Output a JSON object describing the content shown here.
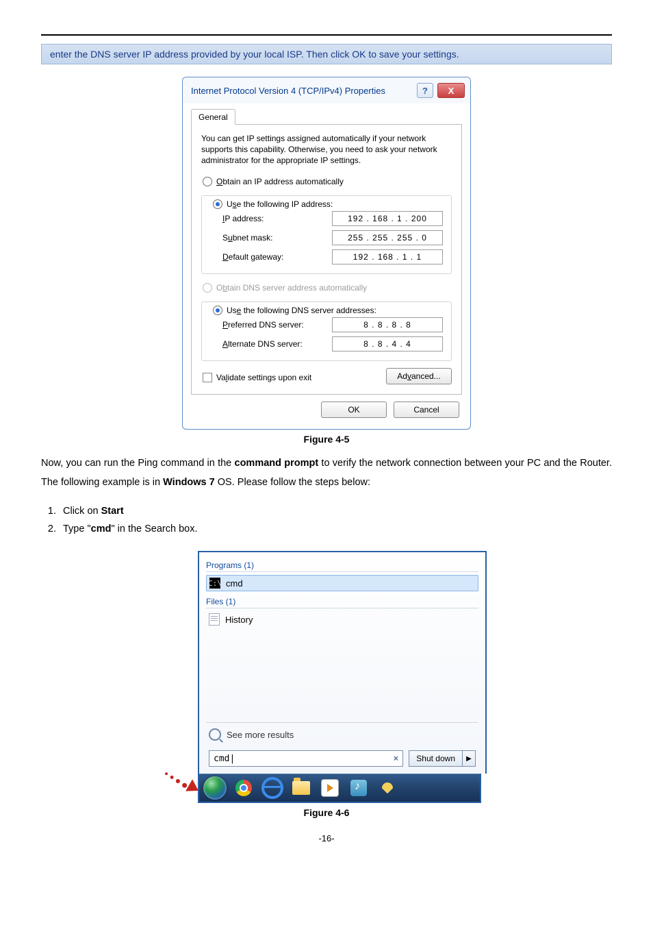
{
  "banner": "enter the DNS server IP address provided by your local ISP. Then click OK to save your settings.",
  "dialog": {
    "title": "Internet Protocol Version 4 (TCP/IPv4) Properties",
    "tab": "General",
    "blurb": "You can get IP settings assigned automatically if your network supports this capability. Otherwise, you need to ask your network administrator for the appropriate IP settings.",
    "radio_obtain_ip": "Obtain an IP address automatically",
    "radio_use_ip": "Use the following IP address:",
    "ip_label": "IP address:",
    "ip_value": "192 . 168 .  1  . 200",
    "subnet_label": "Subnet mask:",
    "subnet_value": "255 . 255 . 255 .  0",
    "gateway_label": "Default gateway:",
    "gateway_value": "192 . 168 .  1  .  1",
    "radio_obtain_dns": "Obtain DNS server address automatically",
    "radio_use_dns": "Use the following DNS server addresses:",
    "pref_dns_label": "Preferred DNS server:",
    "pref_dns_value": "8  .  8  .  8  .  8",
    "alt_dns_label": "Alternate DNS server:",
    "alt_dns_value": "8  .  8  .  4  .  4",
    "validate": "Validate settings upon exit",
    "advanced": "Advanced...",
    "ok": "OK",
    "cancel": "Cancel"
  },
  "fig1_caption": "Figure 4-5",
  "para_before": "Now, you can run the Ping command in the ",
  "para_bold1": "command prompt",
  "para_mid": " to verify the network connection between your PC and the Router. The following example is in ",
  "para_bold2": "Windows 7",
  "para_after": " OS. Please follow the steps below:",
  "list": {
    "i1a": "Click on ",
    "i1b": "Start",
    "i2a": "Type \"",
    "i2b": "cmd",
    "i2c": "\" in the Search box."
  },
  "start": {
    "programs_legend": "Programs (1)",
    "cmd_label": "cmd",
    "files_legend": "Files (1)",
    "history_label": "History",
    "see_more": "See more results",
    "search_value": "cmd",
    "shutdown": "Shut down"
  },
  "fig2_caption": "Figure 4-6",
  "page_num": "-16-"
}
